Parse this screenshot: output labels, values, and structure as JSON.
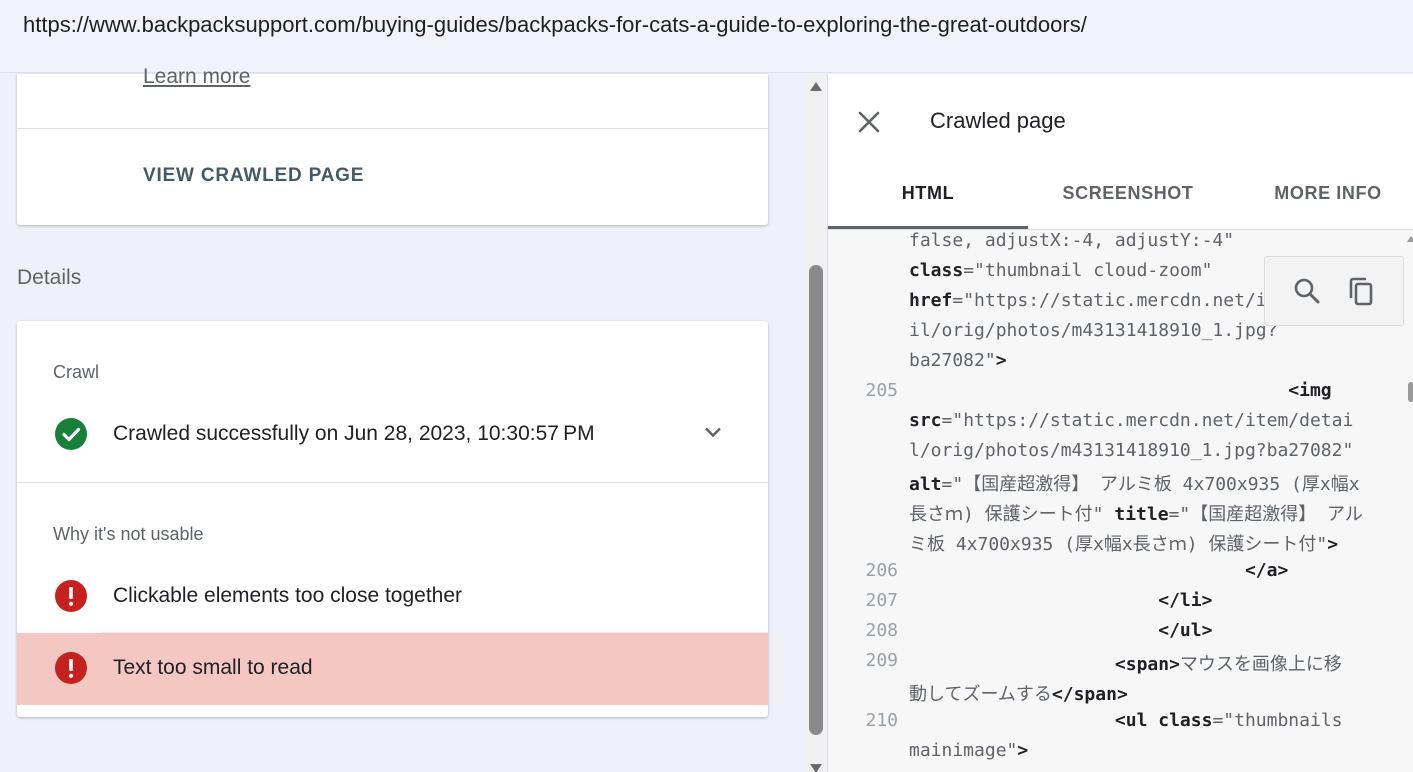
{
  "browser": {
    "url": "https://www.backpacksupport.com/buying-guides/backpacks-for-cats-a-guide-to-exploring-the-great-outdoors/"
  },
  "top_card": {
    "learn_more": "Learn more",
    "view_crawled_page": "VIEW CRAWLED PAGE"
  },
  "details": {
    "heading": "Details",
    "crawl_label": "Crawl",
    "crawl_status": "Crawled successfully on Jun 28, 2023, 10:30:57 PM",
    "why_label": "Why it's not usable",
    "issues": [
      {
        "label": "Clickable elements too close together",
        "icon": "error-icon"
      },
      {
        "label": "Text too small to read",
        "icon": "error-icon",
        "selected": true
      }
    ]
  },
  "panel": {
    "title": "Crawled page",
    "tabs": [
      {
        "label": "HTML",
        "active": true
      },
      {
        "label": "SCREENSHOT",
        "active": false
      },
      {
        "label": "MORE INFO",
        "active": false
      }
    ]
  },
  "code": [
    {
      "num": "",
      "segs": [
        [
          "t",
          "false, adjustX:-4, adjustY:-4\""
        ]
      ]
    },
    {
      "num": "",
      "segs": [
        [
          "k",
          "class"
        ],
        [
          "t",
          "=\"thumbnail cloud-zoom\""
        ]
      ]
    },
    {
      "num": "",
      "segs": [
        [
          "k",
          "href"
        ],
        [
          "t",
          "=\"https://static.mercdn.net/item/deta"
        ]
      ]
    },
    {
      "num": "",
      "segs": [
        [
          "t",
          "il/orig/photos/m43131418910_1.jpg?"
        ]
      ]
    },
    {
      "num": "",
      "segs": [
        [
          "t",
          "ba27082\""
        ],
        [
          "k",
          ">"
        ]
      ]
    },
    {
      "num": "205",
      "segs": [
        [
          "t",
          "                                   "
        ],
        [
          "k",
          "<img"
        ]
      ]
    },
    {
      "num": "",
      "segs": [
        [
          "k",
          "src"
        ],
        [
          "t",
          "=\"https://static.mercdn.net/item/detai"
        ]
      ]
    },
    {
      "num": "",
      "segs": [
        [
          "t",
          "l/orig/photos/m43131418910_1.jpg?ba27082\""
        ]
      ]
    },
    {
      "num": "",
      "segs": [
        [
          "k",
          "alt"
        ],
        [
          "t",
          "=\"【国産超激得】 アルミ板 4x700x935 (厚x幅x"
        ]
      ]
    },
    {
      "num": "",
      "segs": [
        [
          "t",
          "長さｍ) 保護シート付\" "
        ],
        [
          "k",
          "title"
        ],
        [
          "t",
          "=\"【国産超激得】 アル"
        ]
      ]
    },
    {
      "num": "",
      "segs": [
        [
          "t",
          "ミ板 4x700x935 (厚x幅x長さｍ) 保護シート付\""
        ],
        [
          "k",
          ">"
        ]
      ]
    },
    {
      "num": "206",
      "segs": [
        [
          "t",
          "                               "
        ],
        [
          "k",
          "</a>"
        ]
      ]
    },
    {
      "num": "207",
      "segs": [
        [
          "t",
          "                       "
        ],
        [
          "k",
          "</li>"
        ]
      ]
    },
    {
      "num": "208",
      "segs": [
        [
          "t",
          "                       "
        ],
        [
          "k",
          "</ul>"
        ]
      ]
    },
    {
      "num": "209",
      "segs": [
        [
          "t",
          "                   "
        ],
        [
          "k",
          "<span>"
        ],
        [
          "t",
          "マウスを画像上に移"
        ]
      ]
    },
    {
      "num": "",
      "segs": [
        [
          "t",
          "動してズームする"
        ],
        [
          "k",
          "</span>"
        ]
      ]
    },
    {
      "num": "210",
      "segs": [
        [
          "t",
          "                   "
        ],
        [
          "k",
          "<ul class"
        ],
        [
          "t",
          "=\"thumbnails"
        ]
      ]
    },
    {
      "num": "",
      "segs": [
        [
          "t",
          "mainimage\""
        ],
        [
          "k",
          ">"
        ]
      ]
    }
  ],
  "colors": {
    "success": "#188038",
    "error": "#c5221f",
    "issue_highlight": "#f4c7c3"
  }
}
